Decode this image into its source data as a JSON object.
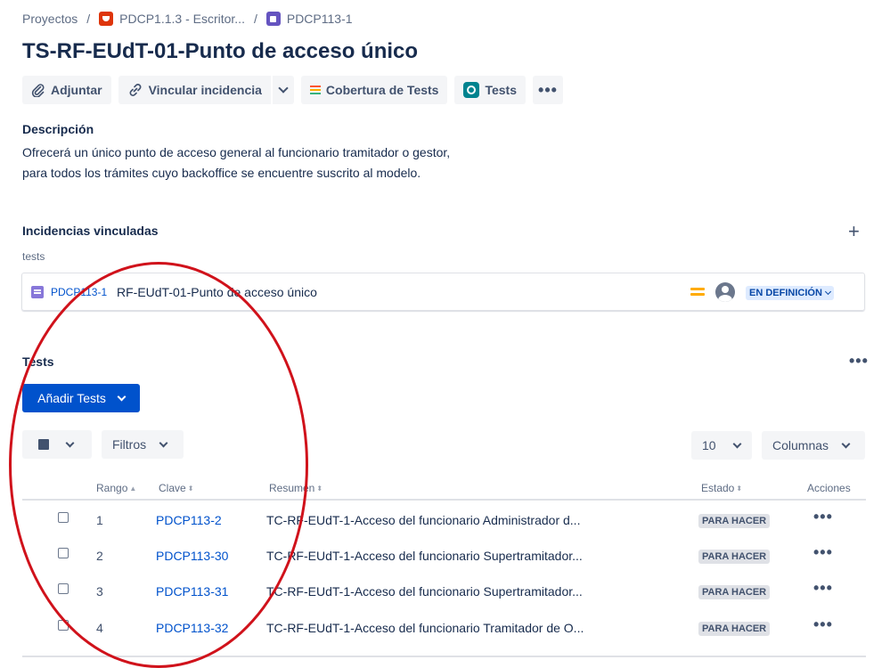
{
  "breadcrumb": {
    "root": "Proyectos",
    "project": "PDCP1.1.3 - Escritor...",
    "issue": "PDCP113-1"
  },
  "issue": {
    "title": "TS-RF-EUdT-01-Punto de acceso único"
  },
  "toolbar": {
    "attach": "Adjuntar",
    "link": "Vincular incidencia",
    "coverage": "Cobertura de Tests",
    "tests": "Tests"
  },
  "description": {
    "label": "Descripción",
    "line1": "Ofrecerá un único punto de acceso general al funcionario tramitador o gestor,",
    "line2": "para todos los trámites cuyo backoffice se encuentre suscrito al modelo."
  },
  "linked": {
    "label": "Incidencias vinculadas",
    "group": "tests",
    "item": {
      "key": "PDCP113-1",
      "summary": "RF-EUdT-01-Punto de acceso único",
      "status": "EN DEFINICIÓN",
      "priority_color": "#ffab00"
    }
  },
  "tests": {
    "label": "Tests",
    "add_button": "Añadir Tests",
    "filters": "Filtros",
    "page_size": "10",
    "columns": "Columnas",
    "headers": {
      "rank": "Rango",
      "key": "Clave",
      "summary": "Resumen",
      "status": "Estado",
      "actions": "Acciones"
    },
    "rows": [
      {
        "rank": "1",
        "key": "PDCP113-2",
        "summary": "TC-RF-EUdT-1-Acceso del funcionario Administrador d...",
        "status": "PARA HACER"
      },
      {
        "rank": "2",
        "key": "PDCP113-30",
        "summary": "TC-RF-EUdT-1-Acceso del funcionario Supertramitador...",
        "status": "PARA HACER"
      },
      {
        "rank": "3",
        "key": "PDCP113-31",
        "summary": "TC-RF-EUdT-1-Acceso del funcionario Supertramitador...",
        "status": "PARA HACER"
      },
      {
        "rank": "4",
        "key": "PDCP113-32",
        "summary": "TC-RF-EUdT-1-Acceso del funcionario Tramitador de O...",
        "status": "PARA HACER"
      }
    ]
  },
  "colors": {
    "primary": "#0052cc",
    "link": "#0052cc",
    "annotation": "#d0121b"
  }
}
